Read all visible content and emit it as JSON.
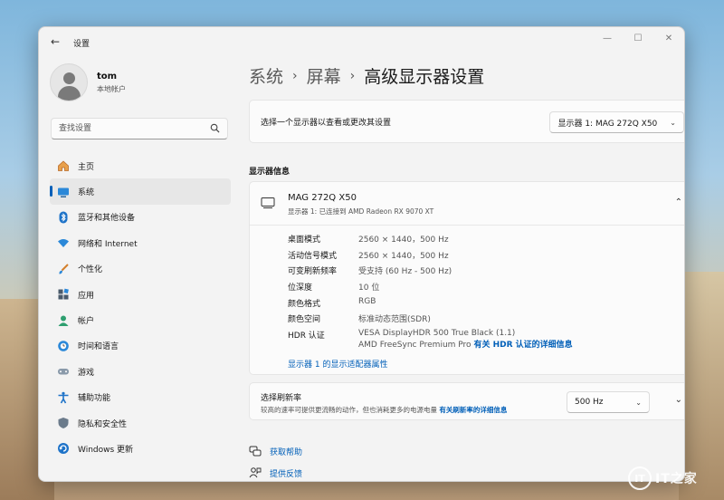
{
  "window": {
    "app_title": "设置",
    "controls": [
      "—",
      "☐",
      "✕"
    ]
  },
  "profile": {
    "name": "tom",
    "account_type": "本地帐户"
  },
  "search": {
    "placeholder": "查找设置"
  },
  "sidebar": {
    "items": [
      {
        "label": "主页",
        "icon": "home-icon"
      },
      {
        "label": "系统",
        "icon": "system-icon",
        "active": true
      },
      {
        "label": "蓝牙和其他设备",
        "icon": "bluetooth-icon"
      },
      {
        "label": "网络和 Internet",
        "icon": "network-icon"
      },
      {
        "label": "个性化",
        "icon": "brush-icon"
      },
      {
        "label": "应用",
        "icon": "apps-icon"
      },
      {
        "label": "帐户",
        "icon": "account-icon"
      },
      {
        "label": "时间和语言",
        "icon": "globe-clock-icon"
      },
      {
        "label": "游戏",
        "icon": "gamepad-icon"
      },
      {
        "label": "辅助功能",
        "icon": "accessibility-icon"
      },
      {
        "label": "隐私和安全性",
        "icon": "shield-icon"
      },
      {
        "label": "Windows 更新",
        "icon": "update-icon"
      }
    ]
  },
  "breadcrumb": {
    "items": [
      "系统",
      "屏幕",
      "高级显示器设置"
    ],
    "separator": "›"
  },
  "select_display": {
    "label": "选择一个显示器以查看或更改其设置",
    "value": "显示器 1: MAG 272Q X50"
  },
  "display_info": {
    "section_title": "显示器信息",
    "name": "MAG 272Q X50",
    "subtitle": "显示器 1: 已连接到 AMD Radeon RX 9070 XT",
    "rows": [
      {
        "key": "桌面模式",
        "value": "2560 × 1440，500 Hz"
      },
      {
        "key": "活动信号模式",
        "value": "2560 × 1440，500 Hz"
      },
      {
        "key": "可变刷新频率",
        "value": "受支持 (60 Hz - 500 Hz)"
      },
      {
        "key": "位深度",
        "value": "10 位"
      },
      {
        "key": "颜色格式",
        "value": "RGB"
      },
      {
        "key": "颜色空间",
        "value": "标准动态范围(SDR)"
      }
    ],
    "hdr": {
      "key": "HDR 认证",
      "line1": "VESA DisplayHDR 500 True Black (1.1)",
      "line2": "AMD FreeSync Premium Pro",
      "link": "有关 HDR 认证的详细信息"
    },
    "adapter_link": "显示器 1 的显示适配器属性"
  },
  "refresh": {
    "title": "选择刷新率",
    "desc": "较高的速率可提供更流畅的动作，但也消耗更多的电源电量",
    "link": "有关刷新率的详细信息",
    "value": "500 Hz"
  },
  "help": {
    "get_help": "获取帮助",
    "feedback": "提供反馈"
  },
  "watermark": {
    "text": "IT之家"
  },
  "colors": {
    "accent": "#005fb8",
    "window_bg": "#f3f3f3",
    "card_bg": "#fbfbfb"
  }
}
